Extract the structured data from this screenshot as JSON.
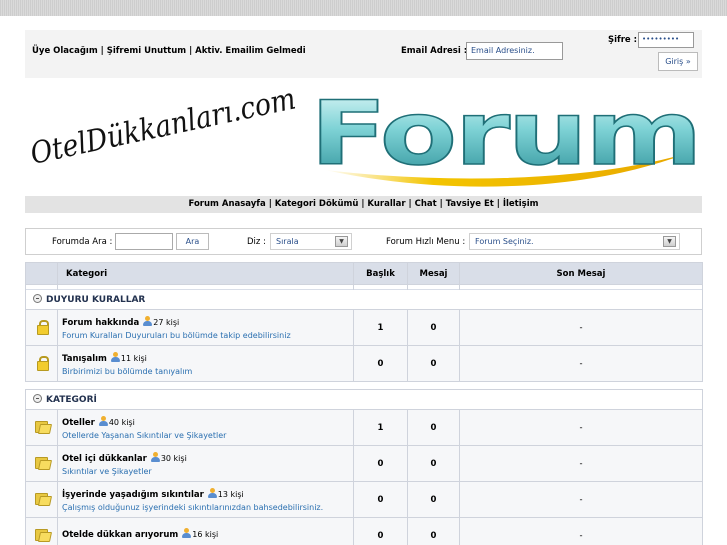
{
  "login": {
    "links": "Üye Olacağım | Şifremi Unuttum | Aktiv. Emailim Gelmedi",
    "email_label": "Email Adresi :",
    "email_placeholder": "Email Adresiniz.",
    "password_label": "Şifre :",
    "password_value": "•••••••••",
    "login_button": "Giriş »"
  },
  "logo": {
    "script_text": "OtelDükkanları.com",
    "forum_text": "Forum"
  },
  "nav": {
    "links": "Forum Anasayfa | Kategori Dökümü | Kurallar | Chat | Tavsiye Et | İletişim"
  },
  "toolbar": {
    "search_label": "Forumda Ara :",
    "search_button": "Ara",
    "sort_label": "Diz :",
    "sort_value": "Sırala",
    "quick_menu_label": "Forum Hızlı Menu :",
    "quick_menu_value": "Forum Seçiniz."
  },
  "table": {
    "headers": {
      "kategori": "Kategori",
      "baslik": "Başlık",
      "mesaj": "Mesaj",
      "son_mesaj": "Son Mesaj"
    },
    "sections": [
      {
        "title": "DUYURU KURALLAR",
        "rows": [
          {
            "icon": "lock-icon",
            "name": "Forum hakkında",
            "users": "27 kişi",
            "desc": "Forum Kuralları Duyuruları bu bölümde takip edebilirsiniz",
            "baslik": "1",
            "mesaj": "0",
            "son": "-"
          },
          {
            "icon": "lock-icon",
            "name": "Tanışalım",
            "users": "11 kişi",
            "desc": "Birbirimizi bu bölümde tanıyalım",
            "baslik": "0",
            "mesaj": "0",
            "son": "-"
          }
        ]
      },
      {
        "title": "KATEGORİ",
        "rows": [
          {
            "icon": "folder-icon",
            "name": "Oteller",
            "users": "40 kişi",
            "desc": "Otellerde Yaşanan Sıkıntılar ve Şikayetler",
            "baslik": "1",
            "mesaj": "0",
            "son": "-"
          },
          {
            "icon": "folder-icon",
            "name": "Otel içi dükkanlar",
            "users": "30 kişi",
            "desc": "Sıkıntılar ve Şikayetler",
            "baslik": "0",
            "mesaj": "0",
            "son": "-"
          },
          {
            "icon": "folder-icon",
            "name": "İşyerinde yaşadığım sıkıntılar",
            "users": "13 kişi",
            "desc": "Çalışmış olduğunuz işyerindeki sıkıntılarınızdan bahsedebilirsiniz.",
            "baslik": "0",
            "mesaj": "0",
            "son": "-"
          },
          {
            "icon": "folder-icon",
            "name": "Otelde dükkan arıyorum",
            "users": "16 kişi",
            "desc": "",
            "baslik": "0",
            "mesaj": "0",
            "son": "-"
          }
        ]
      }
    ]
  }
}
